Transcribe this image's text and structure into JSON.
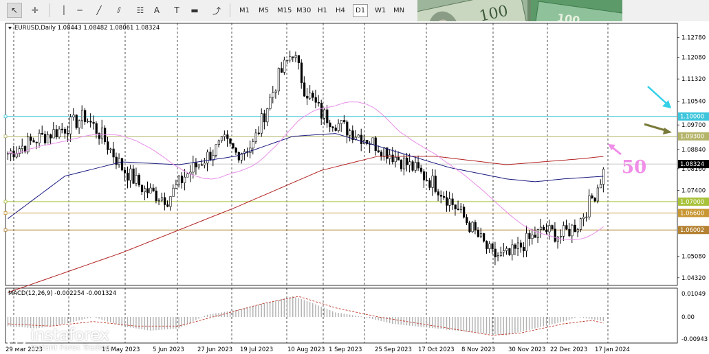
{
  "toolbar": {
    "tools": [
      {
        "name": "cursor-tool",
        "icon": "arrow-cursor-icon",
        "glyph": "↖"
      },
      {
        "name": "crosshair-tool",
        "icon": "crosshair-icon",
        "glyph": "✛"
      },
      {
        "name": "vertical-line-tool",
        "icon": "vertical-line-icon",
        "glyph": "│"
      },
      {
        "name": "horizontal-line-tool",
        "icon": "horizontal-line-icon",
        "glyph": "─"
      },
      {
        "name": "trendline-tool",
        "icon": "trendline-icon",
        "glyph": "╱"
      },
      {
        "name": "equidistant-channel-tool",
        "icon": "channel-icon",
        "glyph": "⫽"
      },
      {
        "name": "fibonacci-tool",
        "icon": "fibonacci-icon",
        "glyph": "☷"
      },
      {
        "name": "text-tool",
        "icon": "text-icon",
        "glyph": "A"
      },
      {
        "name": "text-label-tool",
        "icon": "text-label-icon",
        "glyph": "T"
      },
      {
        "name": "rectangle-tool",
        "icon": "rectangle-icon",
        "glyph": "▬"
      },
      {
        "name": "arrows-tool",
        "icon": "arrows-icon",
        "glyph": "⤴"
      }
    ],
    "timeframes": [
      "M1",
      "M5",
      "M15",
      "M30",
      "H1",
      "H4",
      "D1",
      "W1",
      "MN"
    ],
    "active_timeframe": "D1"
  },
  "chart": {
    "header": "EURUSD,Daily  1.08443 1.08482 1.08061 1.08324",
    "price_labels": [
      "1.12780",
      "1.12080",
      "1.11320",
      "1.10540",
      "1.09700",
      "1.09300",
      "1.08840",
      "1.08324",
      "1.08160",
      "1.07400",
      "1.07000",
      "1.06600",
      "1.06002",
      "1.05080",
      "1.04320"
    ],
    "level_lines": [
      {
        "price": 1.1,
        "label": "1.10000",
        "color": "#3fc6dc"
      },
      {
        "price": 1.093,
        "label": "1.09300",
        "color": "#b4b46a"
      },
      {
        "price": 1.07,
        "label": "1.07000",
        "color": "#a8c23a"
      },
      {
        "price": 1.066,
        "label": "1.06600",
        "color": "#c89632"
      },
      {
        "price": 1.06002,
        "label": "1.06002",
        "color": "#b48232"
      }
    ],
    "current_price": "1.08324",
    "ma_annotation": "50",
    "date_labels": [
      "29 Mar 2023",
      "15 May 2023",
      "5 Jun 2023",
      "27 Jun 2023",
      "19 Jul 2023",
      "10 Aug 2023",
      "1 Sep 2023",
      "25 Sep 2023",
      "17 Oct 2023",
      "8 Nov 2023",
      "30 Nov 2023",
      "22 Dec 2023",
      "17 Jan 2024"
    ],
    "macd_header": "MACD(12,26,9) -0.002254 -0.001324",
    "macd_labels": [
      "0.01049",
      "0.00",
      "-0.00943"
    ]
  },
  "watermark": {
    "brand": "instaforex",
    "tagline": "Instant Forex Trading"
  },
  "colors": {
    "ma200": "#b22222",
    "ma100": "#1a1a80",
    "ma50": "#e88ee8",
    "arrow_cyan": "#33d0e8",
    "arrow_olive": "#7a7a3a",
    "arrow_pink": "#f08ee8",
    "candle": "#000000"
  }
}
